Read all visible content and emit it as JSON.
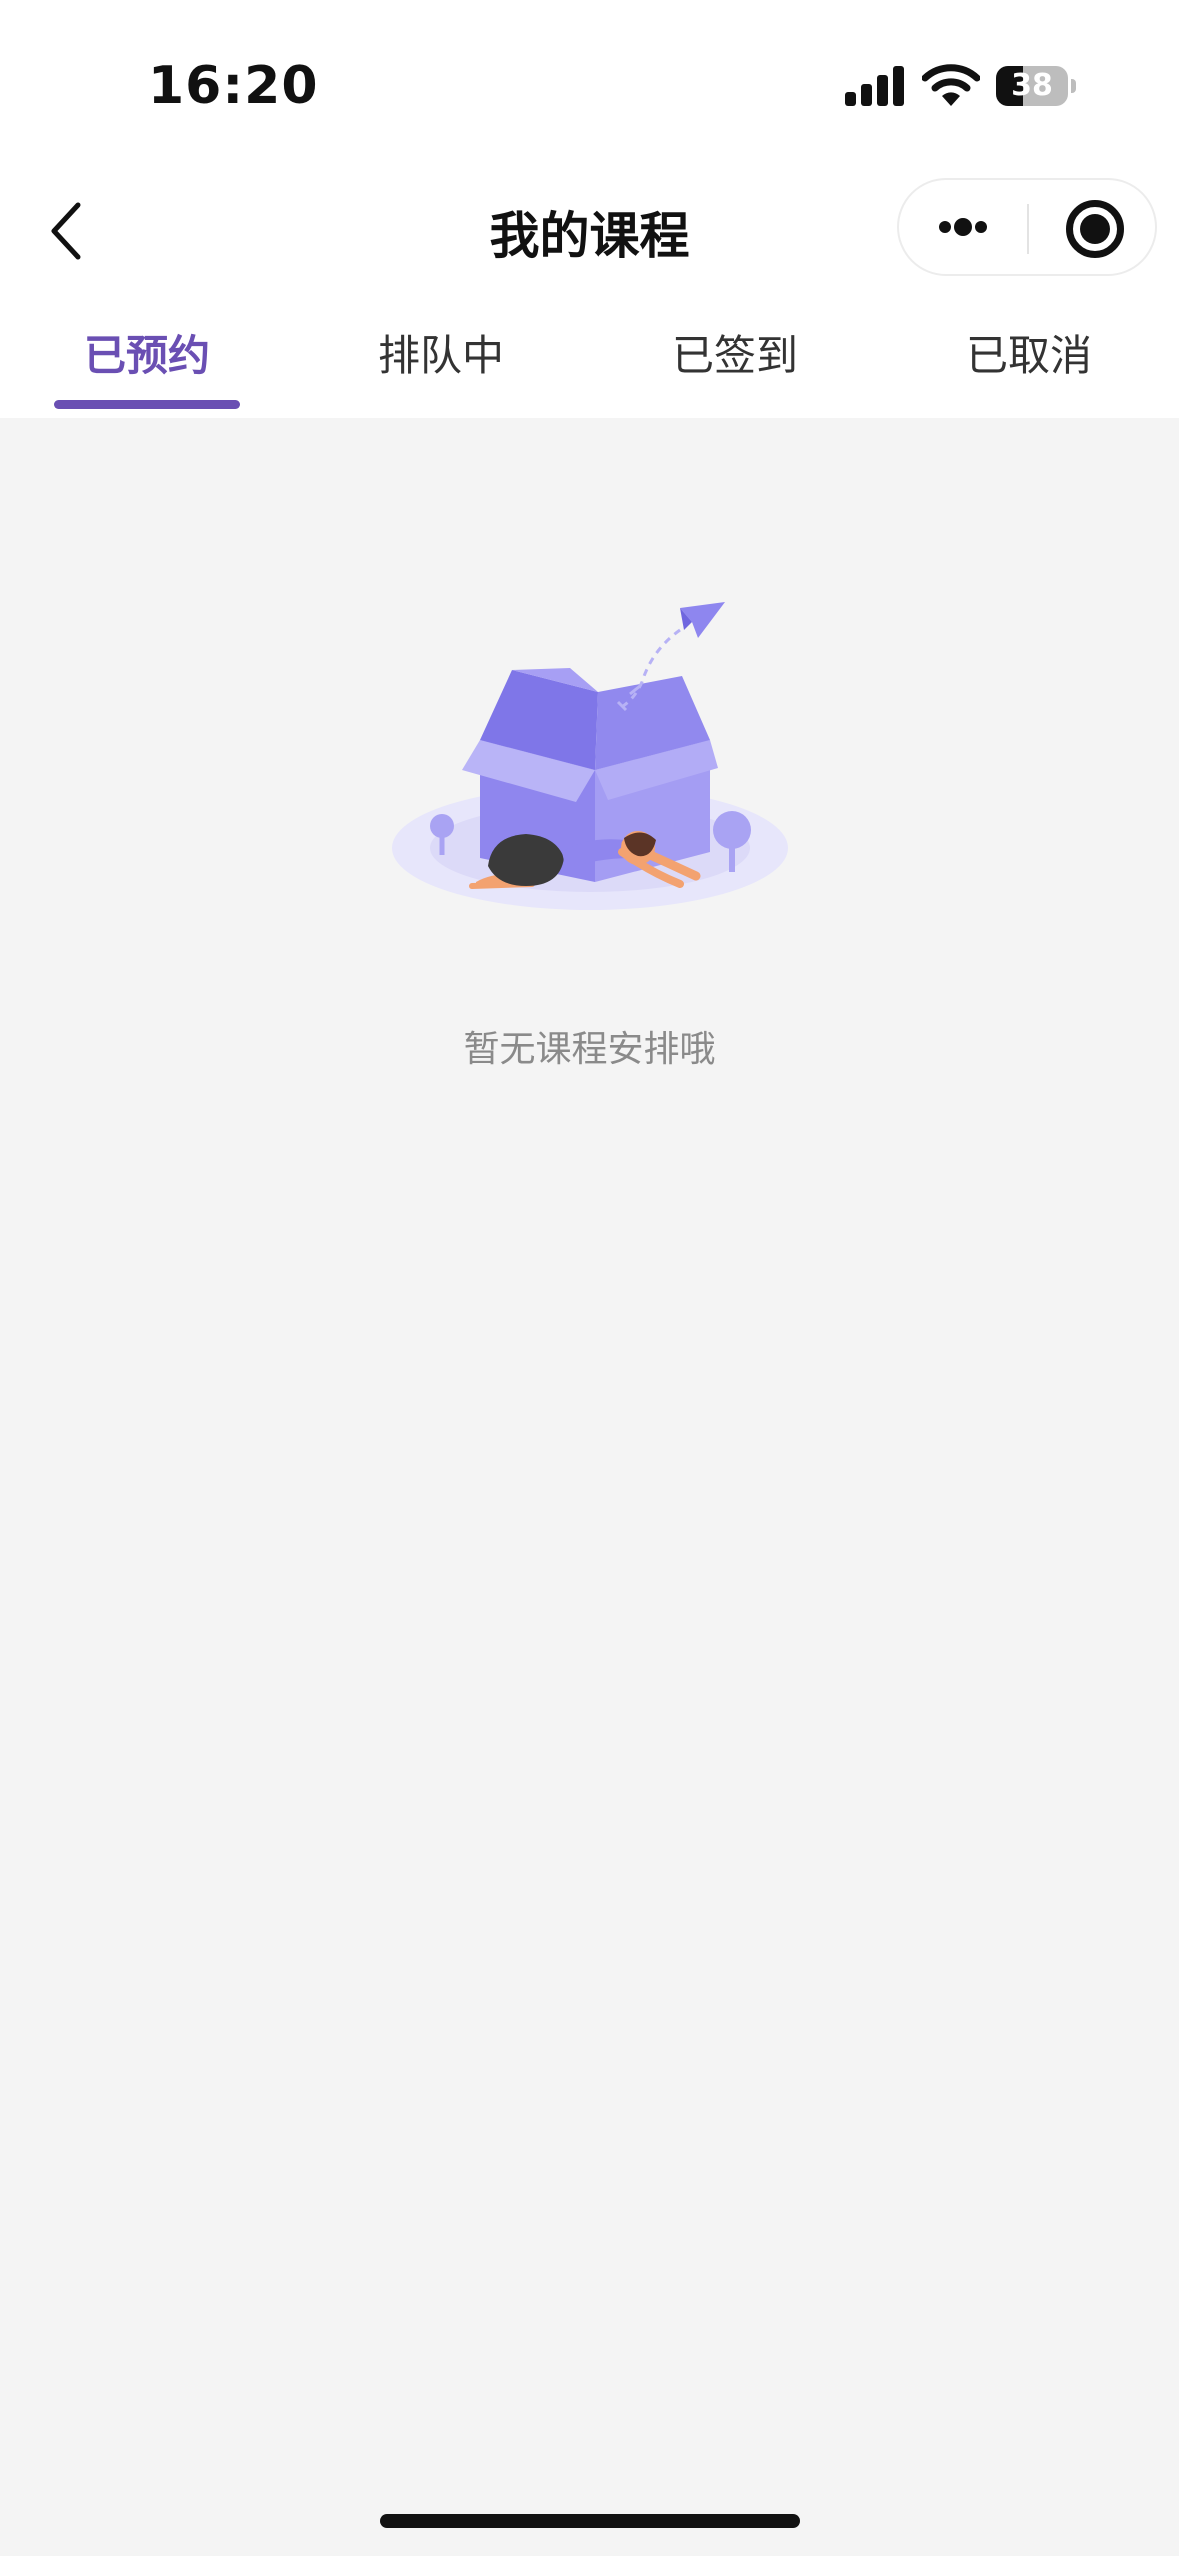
{
  "status_bar": {
    "time": "16:20",
    "battery": "38",
    "battery_level": 0.38
  },
  "nav": {
    "title": "我的课程"
  },
  "tabs": [
    {
      "label": "已预约",
      "active": true
    },
    {
      "label": "排队中",
      "active": false
    },
    {
      "label": "已签到",
      "active": false
    },
    {
      "label": "已取消",
      "active": false
    }
  ],
  "empty_state": {
    "message": "暂无课程安排哦",
    "illustration": "open-box-yoga-illustration"
  },
  "colors": {
    "accent": "#6a4fb3",
    "illustration": "#9b94f2",
    "background": "#f4f4f4"
  }
}
